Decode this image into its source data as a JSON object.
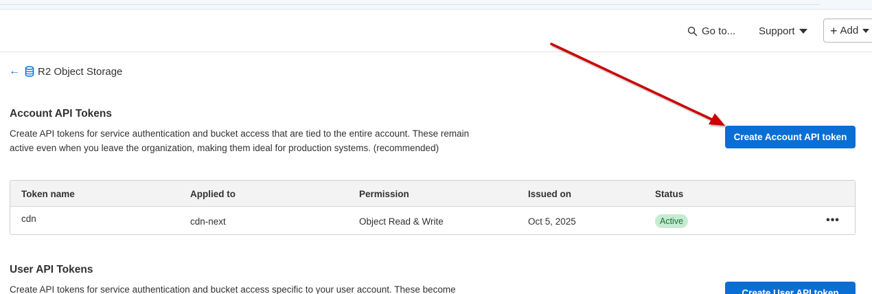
{
  "header": {
    "goto_label": "Go to...",
    "support_label": "Support",
    "add_label": "Add"
  },
  "breadcrumb": {
    "title": "R2 Object Storage"
  },
  "account_tokens": {
    "title": "Account API Tokens",
    "description": "Create API tokens for service authentication and bucket access that are tied to the entire account. These remain active even when you leave the organization, making them ideal for production systems. (recommended)",
    "create_button": "Create Account API token",
    "columns": [
      "Token name",
      "Applied to",
      "Permission",
      "Issued on",
      "Status"
    ],
    "rows": [
      {
        "token_name": "cdn",
        "applied_to": "cdn-next",
        "permission": "Object Read & Write",
        "issued_on": "Oct 5, 2025",
        "status": "Active",
        "menu": "•••"
      }
    ]
  },
  "user_tokens": {
    "title": "User API Tokens",
    "description": "Create API tokens for service authentication and bucket access specific to your user account. These become",
    "create_button": "Create User API token"
  },
  "colors": {
    "accent": "#0b6ed5",
    "annotation_arrow": "#cc0000",
    "status_active_bg": "#c4ecd1"
  }
}
